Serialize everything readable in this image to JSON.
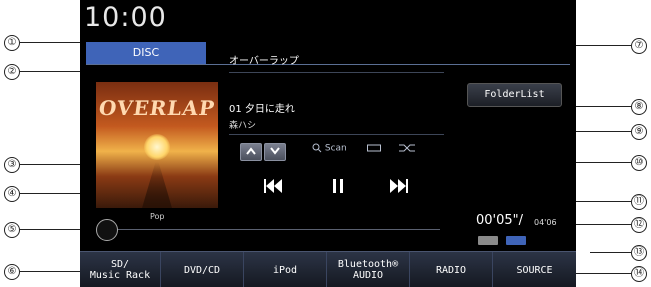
{
  "callouts": [
    "①",
    "②",
    "③",
    "④",
    "⑤",
    "⑥",
    "⑦",
    "⑧",
    "⑨",
    "⑩",
    "⑪",
    "⑫",
    "⑬",
    "⑭"
  ],
  "screen": {
    "clock": "10:00",
    "source_tab": "DISC",
    "album_art_logo": "OVERLAP",
    "genre": "Pop",
    "album": "オーバーラップ",
    "track": "01 夕日に走れ",
    "artist": "森ハシ",
    "folder_list_label": "FolderList",
    "scan_label": "Scan",
    "elapsed": "00'05\"/",
    "total": "04'06",
    "badge_a": "",
    "badge_b": "",
    "bottom_buttons": [
      {
        "label_line1": "SD/",
        "label_line2": "Music Rack"
      },
      {
        "label_line1": "DVD/CD",
        "label_line2": ""
      },
      {
        "label_line1": "iPod",
        "label_line2": ""
      },
      {
        "label_line1": "Bluetooth®",
        "label_line2": "AUDIO"
      },
      {
        "label_line1": "RADIO",
        "label_line2": ""
      },
      {
        "label_line1": "SOURCE",
        "label_line2": ""
      }
    ]
  },
  "colors": {
    "screen_bg": "#000000",
    "accent_blue": "#3f64b8",
    "text": "#ffffff"
  }
}
